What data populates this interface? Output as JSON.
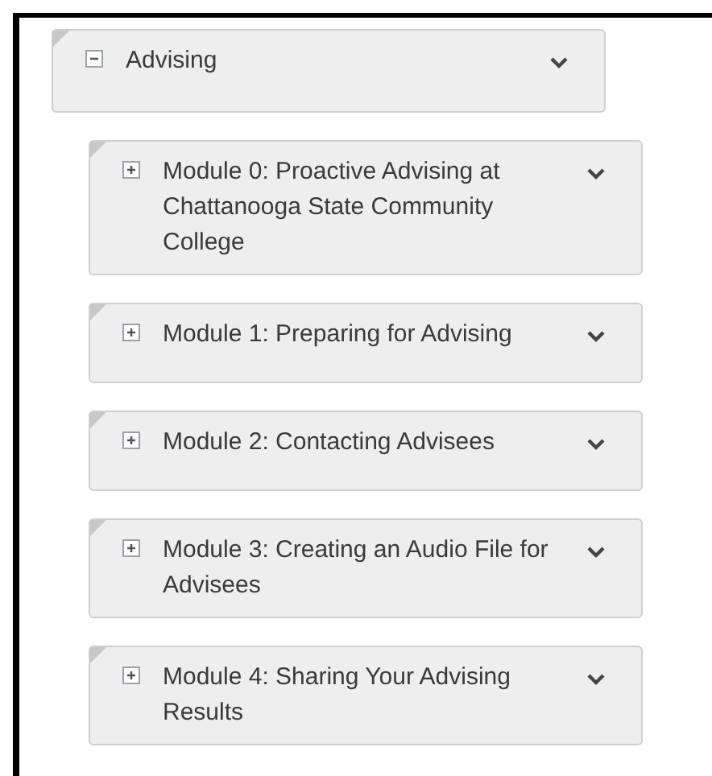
{
  "module": {
    "title": "Advising",
    "expanded": true,
    "children": [
      {
        "title": "Module 0: Proactive Advising at Chattanooga State Community College",
        "expanded": false
      },
      {
        "title": "Module 1: Preparing for Advising",
        "expanded": false
      },
      {
        "title": "Module 2: Contacting Advisees",
        "expanded": false
      },
      {
        "title": "Module 3: Creating an Audio File for Advisees",
        "expanded": false
      },
      {
        "title": "Module 4: Sharing Your Advising Results",
        "expanded": false
      }
    ]
  }
}
